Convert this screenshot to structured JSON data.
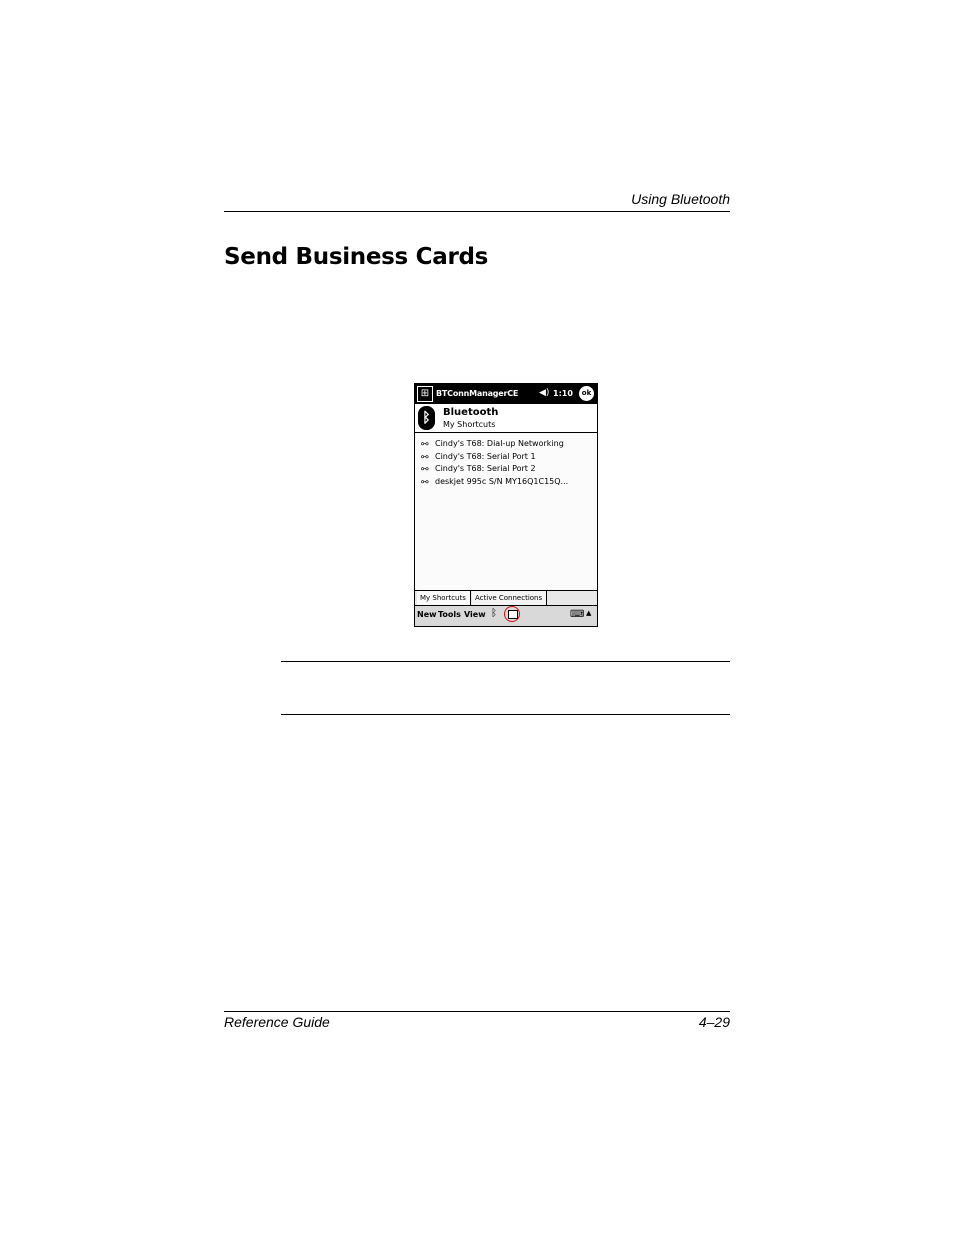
{
  "header": {
    "running_head": "Using Bluetooth"
  },
  "section": {
    "title": "Send Business Cards"
  },
  "device": {
    "app_title": "BTConnManagerCE",
    "time": "1:10",
    "ok_label": "ok",
    "heading": "Bluetooth",
    "subheading": "My Shortcuts",
    "shortcuts": [
      "Cindy's T68: Dial-up Networking",
      "Cindy's T68: Serial Port 1",
      "Cindy's T68: Serial Port 2",
      "deskjet 995c S/N MY16Q1C15Q..."
    ],
    "tabs": [
      "My Shortcuts",
      "Active Connections"
    ],
    "menu": {
      "new": "New",
      "tools": "Tools",
      "view": "View"
    },
    "icons": [
      "windows-start-icon",
      "speaker-icon",
      "bluetooth-icon",
      "business-card-icon",
      "keyboard-icon",
      "arrow-up-icon"
    ]
  },
  "footer": {
    "left": "Reference Guide",
    "right": "4–29"
  }
}
